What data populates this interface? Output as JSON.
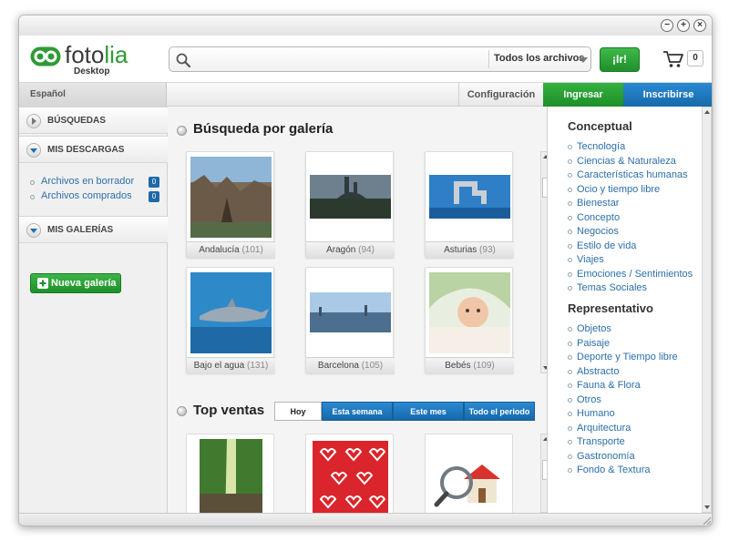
{
  "window": {
    "controls": {
      "minimize": "−",
      "maximize": "+",
      "close": "×"
    }
  },
  "logo": {
    "name_a": "foto",
    "name_b": "lia",
    "subtitle": "Desktop"
  },
  "search": {
    "placeholder": "",
    "value": "",
    "scope": "Todos los archivos",
    "go_label": "¡Ir!"
  },
  "cart": {
    "count": "0"
  },
  "nav": {
    "language": "Español",
    "config": "Configuración",
    "login": "Ingresar",
    "signup": "Inscribirse"
  },
  "sidebar": {
    "searches": "BÚSQUEDAS",
    "downloads": "MIS DESCARGAS",
    "download_links": [
      {
        "label": "Archivos en borrador",
        "count": "0"
      },
      {
        "label": "Archivos comprados",
        "count": "0"
      }
    ],
    "galleries": "MIS GALERÍAS",
    "new_gallery": "Nueva galería"
  },
  "gallery": {
    "title": "Búsqueda por galería",
    "items": [
      {
        "name": "Andalucía",
        "count": "(101)"
      },
      {
        "name": "Aragón",
        "count": "(94)"
      },
      {
        "name": "Asturias",
        "count": "(93)"
      },
      {
        "name": "Bajo el agua",
        "count": "(131)"
      },
      {
        "name": "Barcelona",
        "count": "(105)"
      },
      {
        "name": "Bebés",
        "count": "(109)"
      }
    ]
  },
  "top_sales": {
    "title": "Top ventas",
    "tabs": [
      "Hoy",
      "Esta semana",
      "Este mes",
      "Todo el periodo"
    ],
    "active_tab": 0
  },
  "categories": {
    "conceptual_title": "Conceptual",
    "conceptual": [
      "Tecnología",
      "Ciencias & Naturaleza",
      "Características humanas",
      "Ocio y tiempo libre",
      "Bienestar",
      "Concepto",
      "Negocios",
      "Estilo de vida",
      "Viajes",
      "Emociones / Sentimientos",
      "Temas Sociales"
    ],
    "representative_title": "Representativo",
    "representative": [
      "Objetos",
      "Paisaje",
      "Deporte y Tiempo libre",
      "Abstracto",
      "Fauna & Flora",
      "Otros",
      "Humano",
      "Arquitectura",
      "Transporte",
      "Gastronomía",
      "Fondo & Textura"
    ]
  },
  "colors": {
    "brand_green": "#2f9b35",
    "accent_blue": "#1f6fb3",
    "link_blue": "#2c6fa8"
  }
}
